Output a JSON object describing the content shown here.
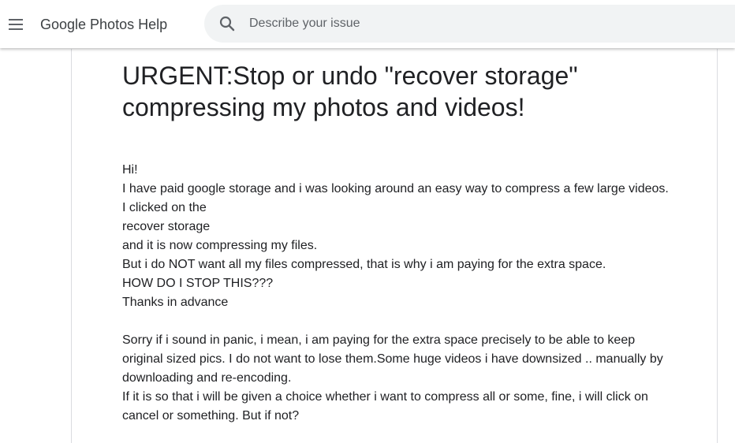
{
  "header": {
    "app_title": "Google Photos Help",
    "search_placeholder": "Describe your issue"
  },
  "post": {
    "title": "URGENT:Stop or undo \"recover storage\" compressing my photos and videos!",
    "lines_part1": [
      "Hi!",
      "I have paid google storage and i was looking around an easy way to compress a few large videos. I clicked on the",
      "recover storage",
      "and it is now compressing my files.",
      "But i do NOT want all my files compressed, that is why i am paying for the extra space.",
      "HOW DO I STOP THIS???",
      "Thanks in advance"
    ],
    "lines_part2": [
      "Sorry if i sound in panic, i mean, i am paying for the extra space precisely to be able to keep original sized pics. I do not want to lose them.Some huge videos i have downsized .. manually by downloading and re-encoding.",
      "If it is so that i will be given a choice whether i want to compress all or some, fine, i will click on cancel or something. But if not?"
    ]
  },
  "colors": {
    "text": "#202124",
    "muted": "#5f6368",
    "search_bg": "#f1f3f4",
    "border": "#dadce0"
  }
}
